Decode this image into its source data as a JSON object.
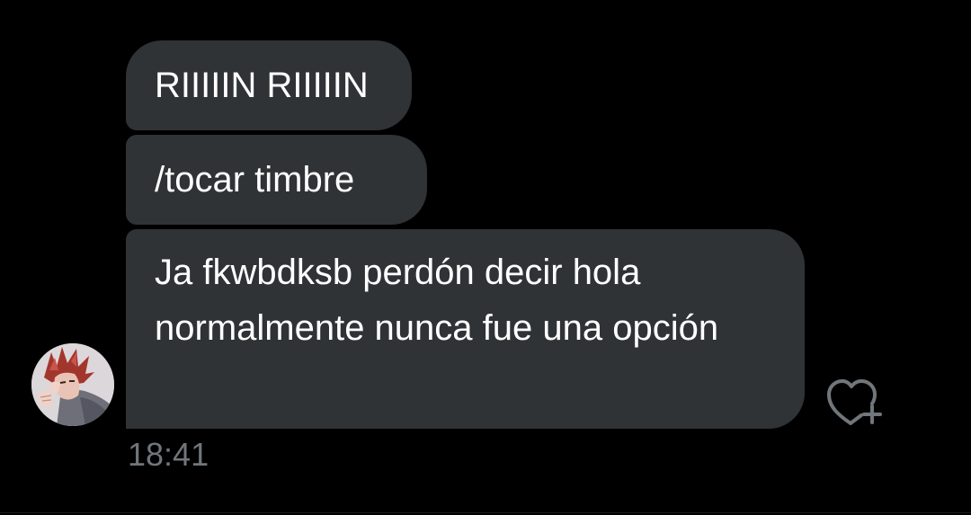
{
  "conversation": {
    "messages": [
      {
        "text": "RIIIIIN RIIIIIN"
      },
      {
        "text": "/tocar timbre"
      },
      {
        "text": "Ja fkwbdksb perdón decir hola normalmente nunca fue una opción"
      }
    ],
    "timestamp": "18:41",
    "sender": {
      "avatar_icon": "user-avatar"
    },
    "reaction": {
      "icon": "heart-add-icon"
    }
  },
  "colors": {
    "background": "#000000",
    "bubble": "#2f3336",
    "text": "#ffffff",
    "muted": "#71767b"
  }
}
